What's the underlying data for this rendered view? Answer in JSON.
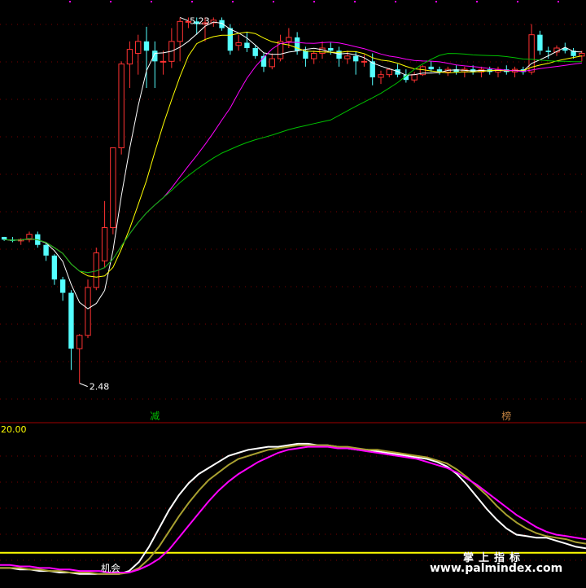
{
  "chart_data": [
    {
      "type": "candlestick",
      "annotations": {
        "high_label": "5.23",
        "high_value": 5.23,
        "low_label": "2.48",
        "low_value": 2.48
      },
      "signals": [
        {
          "index": 18,
          "label": "减",
          "color": "#00c000"
        },
        {
          "index": 60,
          "label": "榜",
          "color": "#c08040"
        }
      ],
      "ylim": [
        2.3,
        5.3
      ],
      "colors": {
        "up": "#ff3232",
        "down": "#54ffff",
        "ma_short": "#ffffff",
        "ma_mid": "#ffff00",
        "ma_long": "#ff00ff",
        "ma_longest": "#00c000"
      },
      "ohlc": [
        [
          3.58,
          3.58,
          3.55,
          3.56
        ],
        [
          3.56,
          3.58,
          3.54,
          3.55
        ],
        [
          3.55,
          3.57,
          3.52,
          3.56
        ],
        [
          3.56,
          3.62,
          3.54,
          3.6
        ],
        [
          3.6,
          3.62,
          3.5,
          3.52
        ],
        [
          3.52,
          3.53,
          3.4,
          3.44
        ],
        [
          3.44,
          3.45,
          3.22,
          3.26
        ],
        [
          3.26,
          3.28,
          3.1,
          3.16
        ],
        [
          3.16,
          3.18,
          2.58,
          2.74
        ],
        [
          2.74,
          2.85,
          2.48,
          2.84
        ],
        [
          2.84,
          3.26,
          2.82,
          3.2
        ],
        [
          3.2,
          3.5,
          3.18,
          3.46
        ],
        [
          3.4,
          3.85,
          3.35,
          3.65
        ],
        [
          3.65,
          4.25,
          3.6,
          4.25
        ],
        [
          4.25,
          4.9,
          4.2,
          4.88
        ],
        [
          4.88,
          5.05,
          4.7,
          4.99
        ],
        [
          4.96,
          5.1,
          4.8,
          5.05
        ],
        [
          5.05,
          5.16,
          4.7,
          4.98
        ],
        [
          4.98,
          5.05,
          4.7,
          4.9
        ],
        [
          4.9,
          4.98,
          4.8,
          4.9
        ],
        [
          4.9,
          5.15,
          4.85,
          5.05
        ],
        [
          5.05,
          5.23,
          4.9,
          5.2
        ],
        [
          5.2,
          5.23,
          5.15,
          5.2
        ],
        [
          5.2,
          5.23,
          5.1,
          5.18
        ],
        [
          5.18,
          5.23,
          5.05,
          5.19
        ],
        [
          5.19,
          5.23,
          5.16,
          5.21
        ],
        [
          5.21,
          5.23,
          5.13,
          5.15
        ],
        [
          5.15,
          5.18,
          4.95,
          4.98
        ],
        [
          5.02,
          5.1,
          4.98,
          5.04
        ],
        [
          5.04,
          5.12,
          4.97,
          5.0
        ],
        [
          5.0,
          5.02,
          4.92,
          4.94
        ],
        [
          4.94,
          4.96,
          4.82,
          4.86
        ],
        [
          4.86,
          4.96,
          4.84,
          4.92
        ],
        [
          4.92,
          5.1,
          4.9,
          5.05
        ],
        [
          5.05,
          5.15,
          5.0,
          5.08
        ],
        [
          5.08,
          5.12,
          4.95,
          4.98
        ],
        [
          4.98,
          5.01,
          4.86,
          4.92
        ],
        [
          4.92,
          4.98,
          4.88,
          4.96
        ],
        [
          4.96,
          5.05,
          4.92,
          5.0
        ],
        [
          5.0,
          5.04,
          4.95,
          4.98
        ],
        [
          4.98,
          5.01,
          4.86,
          4.92
        ],
        [
          4.92,
          4.98,
          4.88,
          4.94
        ],
        [
          4.94,
          4.97,
          4.8,
          4.9
        ],
        [
          4.9,
          4.95,
          4.86,
          4.9
        ],
        [
          4.9,
          4.96,
          4.72,
          4.78
        ],
        [
          4.78,
          4.83,
          4.73,
          4.8
        ],
        [
          4.8,
          4.85,
          4.78,
          4.84
        ],
        [
          4.84,
          4.88,
          4.78,
          4.8
        ],
        [
          4.8,
          4.84,
          4.74,
          4.76
        ],
        [
          4.76,
          4.82,
          4.74,
          4.8
        ],
        [
          4.8,
          4.87,
          4.79,
          4.86
        ],
        [
          4.86,
          4.9,
          4.82,
          4.84
        ],
        [
          4.84,
          4.86,
          4.8,
          4.82
        ],
        [
          4.82,
          4.86,
          4.79,
          4.84
        ],
        [
          4.84,
          4.87,
          4.8,
          4.82
        ],
        [
          4.82,
          4.86,
          4.78,
          4.84
        ],
        [
          4.84,
          4.87,
          4.8,
          4.82
        ],
        [
          4.82,
          4.86,
          4.78,
          4.84
        ],
        [
          4.84,
          4.86,
          4.8,
          4.82
        ],
        [
          4.82,
          4.86,
          4.78,
          4.84
        ],
        [
          4.84,
          4.87,
          4.8,
          4.82
        ],
        [
          4.82,
          4.86,
          4.78,
          4.84
        ],
        [
          4.84,
          4.86,
          4.8,
          4.82
        ],
        [
          4.82,
          5.18,
          4.8,
          5.1
        ],
        [
          5.1,
          5.13,
          4.95,
          4.98
        ],
        [
          4.98,
          5.01,
          4.92,
          4.97
        ],
        [
          4.97,
          5.02,
          4.94,
          5.0
        ],
        [
          5.0,
          5.04,
          4.96,
          4.98
        ],
        [
          4.98,
          5.0,
          4.92,
          4.94
        ],
        [
          4.94,
          4.98,
          4.9,
          4.96
        ]
      ]
    },
    {
      "type": "line",
      "axis_label": "20.00",
      "series": [
        {
          "color": "#ffffff",
          "values": [
            10,
            10,
            9,
            9,
            8,
            8,
            7,
            7,
            6,
            6,
            6,
            6,
            6,
            8,
            14,
            24,
            36,
            48,
            58,
            66,
            72,
            76,
            80,
            84,
            86,
            88,
            89,
            90,
            90,
            91,
            92,
            92,
            91,
            91,
            90,
            89,
            88,
            88,
            87,
            86,
            85,
            84,
            83,
            82,
            80,
            77,
            72,
            65,
            57,
            49,
            42,
            36,
            32,
            31,
            30,
            30,
            28,
            26,
            24,
            23
          ]
        },
        {
          "color": "#a8a030",
          "values": [
            10,
            10,
            10,
            9,
            9,
            8,
            8,
            7,
            7,
            7,
            6,
            6,
            6,
            7,
            10,
            16,
            24,
            34,
            44,
            53,
            61,
            68,
            73,
            78,
            82,
            84,
            86,
            88,
            89,
            90,
            91,
            91,
            91,
            91,
            90,
            90,
            89,
            88,
            88,
            87,
            86,
            85,
            84,
            83,
            81,
            79,
            75,
            70,
            64,
            58,
            51,
            45,
            40,
            36,
            33,
            31,
            30,
            29,
            27,
            26
          ]
        },
        {
          "color": "#ff00ff",
          "values": [
            12,
            12,
            11,
            11,
            10,
            10,
            9,
            9,
            8,
            8,
            8,
            7,
            7,
            7,
            9,
            12,
            16,
            22,
            30,
            38,
            46,
            54,
            61,
            67,
            72,
            76,
            80,
            83,
            86,
            88,
            89,
            90,
            90,
            90,
            89,
            89,
            88,
            87,
            86,
            85,
            84,
            83,
            82,
            80,
            78,
            76,
            73,
            69,
            65,
            60,
            55,
            50,
            45,
            41,
            37,
            34,
            32,
            31,
            30,
            29
          ]
        }
      ],
      "ylim": [
        0,
        100
      ],
      "signals": [
        {
          "index": 10,
          "label": "机会",
          "color": "#ffffff"
        }
      ],
      "threshold": {
        "value": 20,
        "color": "#ffff00"
      }
    }
  ],
  "watermark": {
    "cn": "掌上指标",
    "url": "www.palmindex.com"
  }
}
